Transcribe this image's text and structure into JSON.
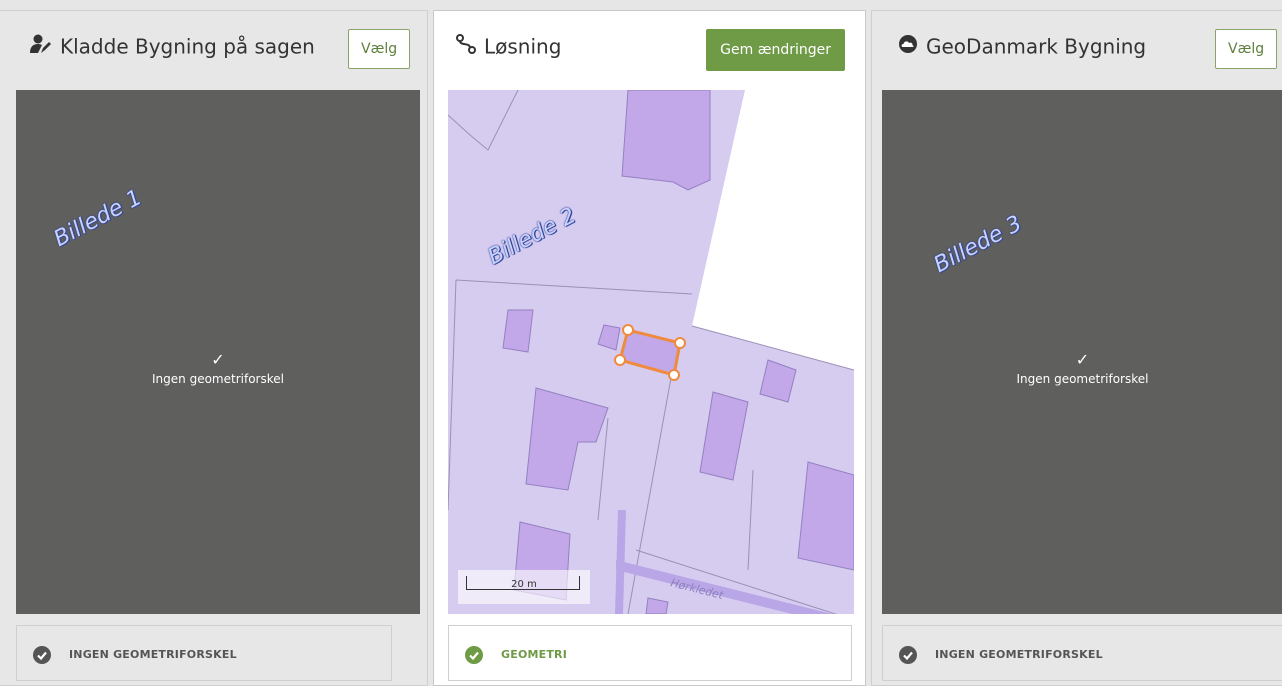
{
  "left_panel": {
    "title": "Kladde Bygning på sagen",
    "icon": "edit-user-icon",
    "select_button": "Vælg",
    "message": "Ingen geometriforskel",
    "overlay_label": "Billede 1",
    "footer_status": "INGEN GEOMETRIFORSKEL",
    "footer_color": "#555555"
  },
  "middle_panel": {
    "title": "Løsning",
    "icon": "route-icon",
    "save_button": "Gem ændringer",
    "overlay_label": "Billede 2",
    "scale_label": "20 m",
    "street_name": "Hørkledet",
    "footer_status": "GEOMETRI",
    "footer_color": "#6f9a46"
  },
  "right_panel": {
    "title": "GeoDanmark Bygning",
    "icon": "cloud-icon",
    "select_button": "Vælg",
    "message": "Ingen geometriforskel",
    "overlay_label": "Billede 3",
    "footer_status": "INGEN GEOMETRIFORSKEL",
    "footer_color": "#555555"
  },
  "colors": {
    "accent_green": "#6f9a46",
    "map_parcel": "#d6ccf0",
    "map_building": "#c2a8e8",
    "selection_orange": "#f08a3c",
    "dark_view": "#5f5f5e"
  }
}
